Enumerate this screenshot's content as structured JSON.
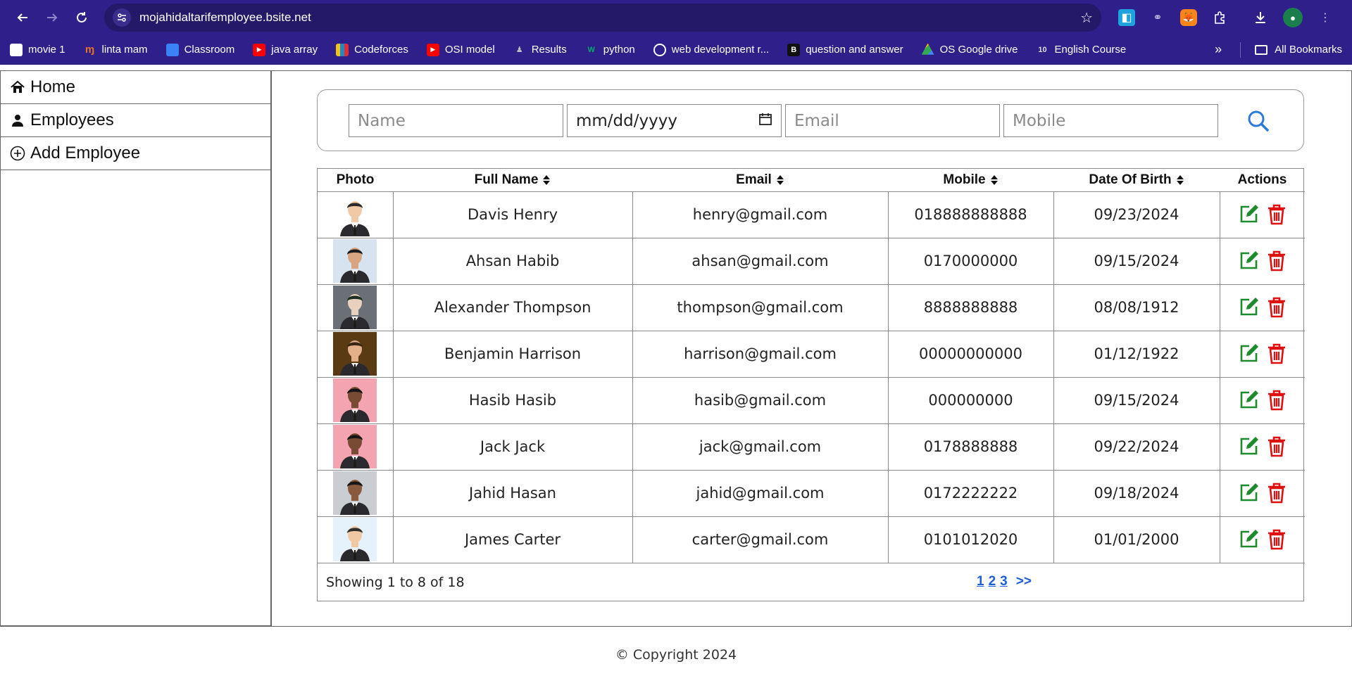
{
  "browser": {
    "url": "mojahidaltarifemployee.bsite.net",
    "bookmarks": [
      {
        "label": "movie 1",
        "icon": "blank-page-icon",
        "color": "#ffffff"
      },
      {
        "label": "linta mam",
        "icon": "m-logo-icon",
        "color": "#e8712b"
      },
      {
        "label": "Classroom",
        "icon": "classroom-icon",
        "color": "#3b82f6"
      },
      {
        "label": "java array",
        "icon": "youtube-icon",
        "color": "#ff0000"
      },
      {
        "label": "Codeforces",
        "icon": "codeforces-icon",
        "color": "#f5c211"
      },
      {
        "label": "OSI model",
        "icon": "youtube-icon",
        "color": "#ff0000"
      },
      {
        "label": "Results",
        "icon": "results-icon",
        "color": "#444444"
      },
      {
        "label": "python",
        "icon": "w3-icon",
        "color": "#04aa6d"
      },
      {
        "label": "web development r...",
        "icon": "globe-icon",
        "color": "#ffffff"
      },
      {
        "label": "question and answer",
        "icon": "b-logo-icon",
        "color": "#111111"
      },
      {
        "label": "OS Google drive",
        "icon": "drive-icon",
        "color": "#34a853"
      },
      {
        "label": "English Course",
        "icon": "ten-icon",
        "color": "#222222"
      }
    ],
    "more_label": "»",
    "all_bookmarks_label": "All Bookmarks"
  },
  "sidebar": {
    "items": [
      {
        "label": "Home",
        "icon": "home-icon"
      },
      {
        "label": "Employees",
        "icon": "person-icon"
      },
      {
        "label": "Add Employee",
        "icon": "plus-circle-icon"
      }
    ]
  },
  "search": {
    "name_placeholder": "Name",
    "date_placeholder": "mm/dd/yyyy",
    "email_placeholder": "Email",
    "mobile_placeholder": "Mobile"
  },
  "table": {
    "headers": {
      "photo": "Photo",
      "full_name": "Full Name",
      "email": "Email",
      "mobile": "Mobile",
      "dob": "Date Of Birth",
      "actions": "Actions"
    },
    "rows": [
      {
        "name": "Davis Henry",
        "email": "henry@gmail.com",
        "mobile": "018888888888",
        "dob": "09/23/2024",
        "photo_bg": "#ffffff",
        "skin": "#f2c9a6",
        "hair": "#2b2b2b"
      },
      {
        "name": "Ahsan Habib",
        "email": "ahsan@gmail.com",
        "mobile": "0170000000",
        "dob": "09/15/2024",
        "photo_bg": "#d7e3ee",
        "skin": "#d8a583",
        "hair": "#1c1c1c"
      },
      {
        "name": "Alexander Thompson",
        "email": "thompson@gmail.com",
        "mobile": "8888888888",
        "dob": "08/08/1912",
        "photo_bg": "#6b6f76",
        "skin": "#e9d1bf",
        "hair": "#1e2d22"
      },
      {
        "name": "Benjamin Harrison",
        "email": "harrison@gmail.com",
        "mobile": "00000000000",
        "dob": "01/12/1922",
        "photo_bg": "#5a3a12",
        "skin": "#e3b08a",
        "hair": "#3a2614"
      },
      {
        "name": "Hasib Hasib",
        "email": "hasib@gmail.com",
        "mobile": "000000000",
        "dob": "09/15/2024",
        "photo_bg": "#f4a3b0",
        "skin": "#7a4b34",
        "hair": "#161616"
      },
      {
        "name": "Jack Jack",
        "email": "jack@gmail.com",
        "mobile": "0178888888",
        "dob": "09/22/2024",
        "photo_bg": "#f4a3b0",
        "skin": "#7a4b34",
        "hair": "#161616"
      },
      {
        "name": "Jahid Hasan",
        "email": "jahid@gmail.com",
        "mobile": "0172222222",
        "dob": "09/18/2024",
        "photo_bg": "#c9ccd0",
        "skin": "#8a5a3e",
        "hair": "#161616"
      },
      {
        "name": "James Carter",
        "email": "carter@gmail.com",
        "mobile": "0101012020",
        "dob": "01/01/2000",
        "photo_bg": "#e6f2fb",
        "skin": "#f0c8a4",
        "hair": "#2f2f2f"
      }
    ],
    "showing_text": "Showing 1 to 8 of 18",
    "pages": [
      "1",
      "2",
      "3"
    ],
    "next_label": ">>"
  },
  "footer": {
    "copyright": "© Copyright 2024"
  },
  "colors": {
    "edit": "#1e8a2e",
    "delete": "#e01010",
    "search_icon": "#2b7bd6",
    "link": "#1f5fd6"
  }
}
